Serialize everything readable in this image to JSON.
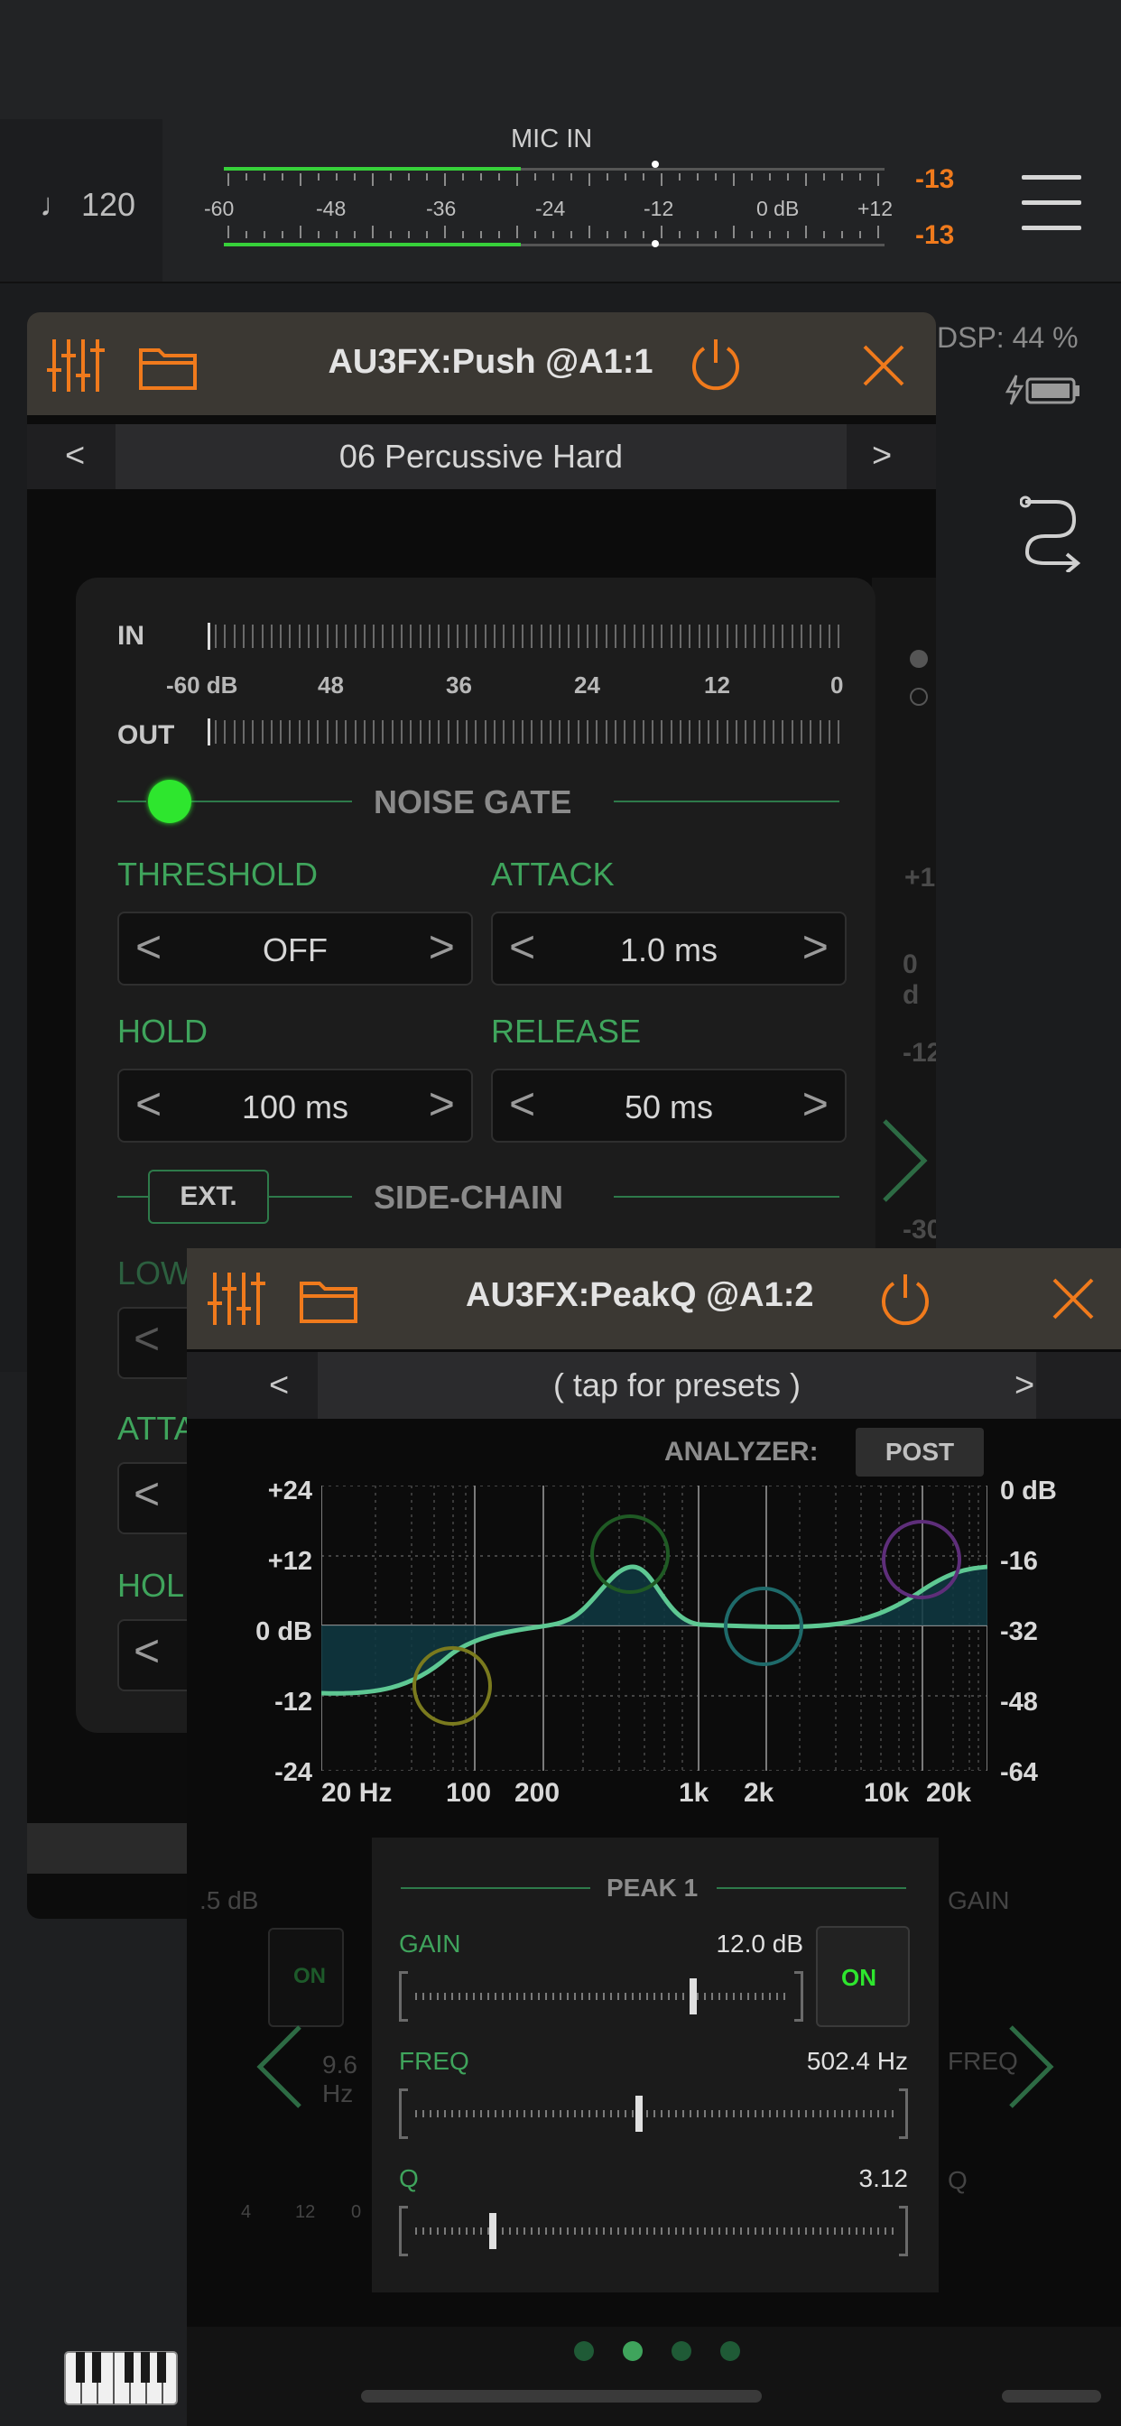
{
  "topbar": {
    "tempo": "♩ 120",
    "meter_title": "MIC IN",
    "scale_labels": [
      "-60",
      "-48",
      "-36",
      "-24",
      "-12",
      "0 dB",
      "+12"
    ],
    "peak_left": "-13",
    "peak_right": "-13",
    "level_fraction": 0.45
  },
  "dsp": {
    "label": "DSP: 44 %"
  },
  "push_window": {
    "title": "AU3FX:Push @A1:1",
    "preset_prev": "<",
    "preset_name": "06 Percussive Hard",
    "preset_next": ">",
    "meter_in_label": "IN",
    "meter_out_label": "OUT",
    "meter_scale": [
      "-60 dB",
      "48",
      "36",
      "24",
      "12",
      "0"
    ],
    "noise_gate_label": "NOISE GATE",
    "noise_gate_on": true,
    "controls": [
      {
        "label": "THRESHOLD",
        "value": "OFF"
      },
      {
        "label": "ATTACK",
        "value": "1.0 ms"
      },
      {
        "label": "HOLD",
        "value": "100 ms"
      },
      {
        "label": "RELEASE",
        "value": "50 ms"
      }
    ],
    "ext_button": "EXT.",
    "side_chain_label": "SIDE-CHAIN",
    "partial_labels": [
      "LOW",
      "ATTA",
      "HOL"
    ],
    "right_partial": [
      "+1",
      "0 d",
      "-12",
      "-30"
    ]
  },
  "peakq_window": {
    "title": "AU3FX:PeakQ @A1:2",
    "preset_prev": "<",
    "preset_name": "( tap for presets )",
    "preset_next": ">",
    "analyzer_label": "ANALYZER:",
    "analyzer_mode": "POST",
    "y_left": [
      "+24",
      "+12",
      "0 dB",
      "-12",
      "-24"
    ],
    "y_right": [
      "0 dB",
      "-16",
      "-32",
      "-48",
      "-64"
    ],
    "x_labels": [
      "20 Hz",
      "100",
      "200",
      "1k",
      "2k",
      "10k",
      "20k"
    ],
    "band": {
      "name": "PEAK 1",
      "gain_label": "GAIN",
      "gain_value": "12.0 dB",
      "gain_fraction": 0.75,
      "on_label": "ON",
      "freq_label": "FREQ",
      "freq_value": "502.4 Hz",
      "freq_fraction": 0.47,
      "q_label": "Q",
      "q_value": "3.12",
      "q_fraction": 0.16
    },
    "ghost_left": {
      "gain_value": ".5 dB",
      "on_label": "ON",
      "freq_value": "9.6 Hz",
      "ticks": [
        "4",
        "12",
        "0"
      ]
    },
    "ghost_right": {
      "gain_label": "GAIN",
      "freq_label": "FREQ",
      "q_label": "Q"
    },
    "page_dots": 4,
    "active_page": 2
  },
  "colors": {
    "accent_orange": "#f07a1c",
    "accent_green": "#3fa45c",
    "meter_green": "#37d13a",
    "led_green": "#2ee62e"
  }
}
